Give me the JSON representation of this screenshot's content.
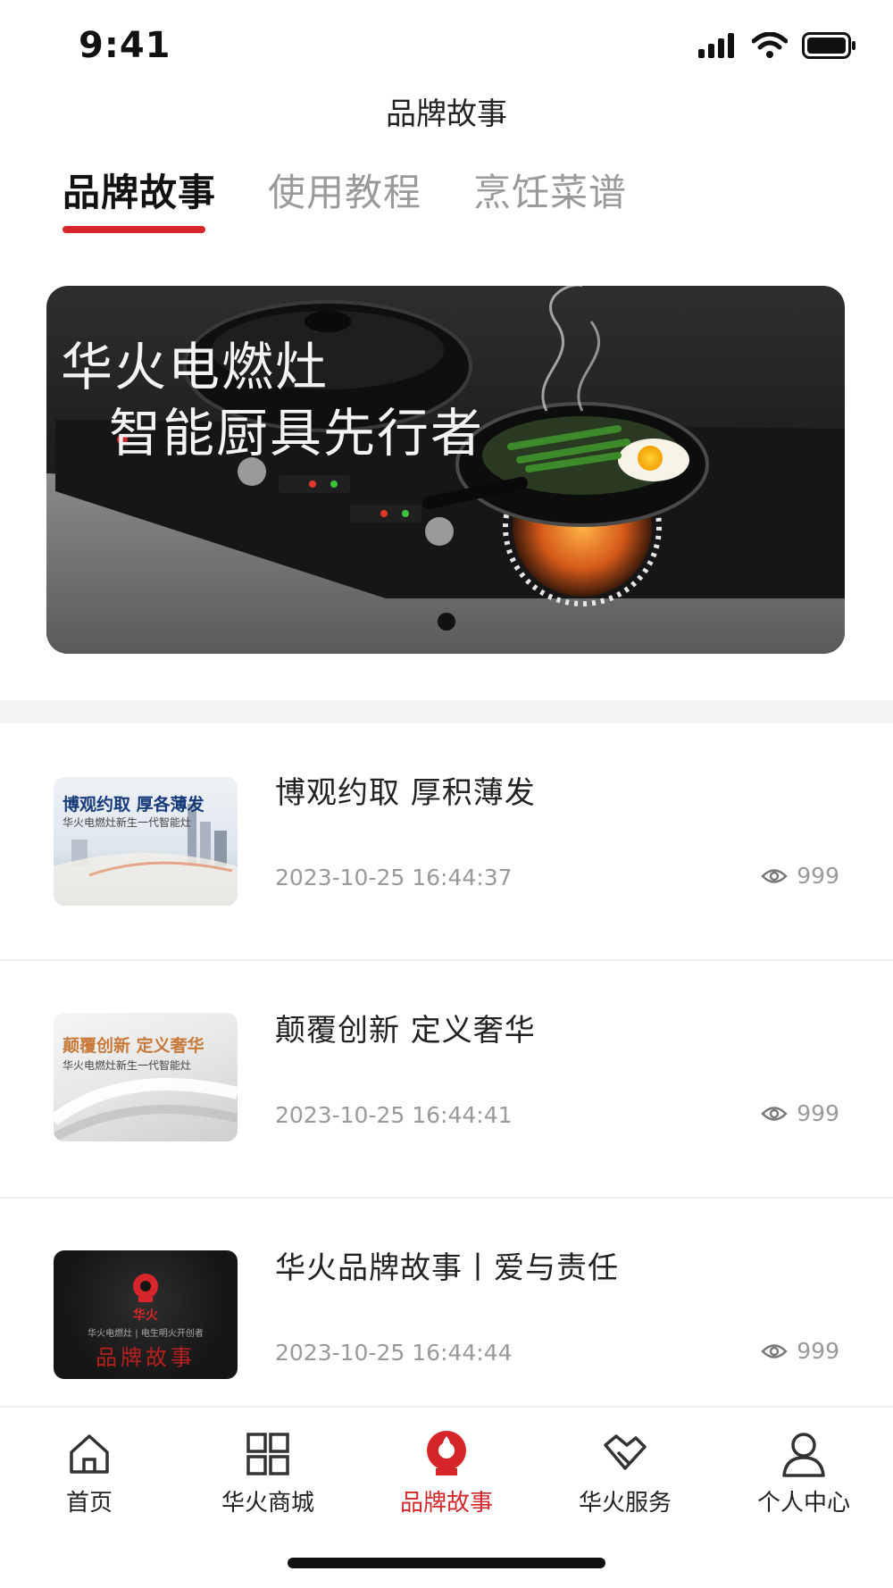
{
  "status_bar": {
    "time": "9:41"
  },
  "header": {
    "title": "品牌故事"
  },
  "tabs": [
    {
      "label": "品牌故事",
      "active": true
    },
    {
      "label": "使用教程",
      "active": false
    },
    {
      "label": "烹饪菜谱",
      "active": false
    }
  ],
  "banner": {
    "line1": "华火电燃灶",
    "line2": "智能厨具先行者",
    "page_count": 1,
    "current_page": 1
  },
  "news": [
    {
      "title": "博观约取 厚积薄发",
      "date": "2023-10-25 16:44:37",
      "views": "999",
      "thumb_title": "博观约取  厚各薄发",
      "thumb_sub": "华火电燃灶新生一代智能灶"
    },
    {
      "title": "颠覆创新 定义奢华",
      "date": "2023-10-25 16:44:41",
      "views": "999",
      "thumb_title": "颠覆创新  定义奢华",
      "thumb_sub": "华火电燃灶新生一代智能灶"
    },
    {
      "title": "华火品牌故事丨爱与责任",
      "date": "2023-10-25 16:44:44",
      "views": "999",
      "thumb_brand": "华火",
      "thumb_sub": "华火电燃灶 | 电生明火开创者",
      "thumb_title": "品牌故事"
    }
  ],
  "bottom_nav": [
    {
      "label": "首页",
      "icon": "home-icon",
      "active": false
    },
    {
      "label": "华火商城",
      "icon": "grid-icon",
      "active": false
    },
    {
      "label": "品牌故事",
      "icon": "brand-flame-icon",
      "active": true
    },
    {
      "label": "华火服务",
      "icon": "service-handshake-icon",
      "active": false
    },
    {
      "label": "个人中心",
      "icon": "user-icon",
      "active": false
    }
  ],
  "colors": {
    "accent": "#d6262a",
    "muted": "#9a9a9a",
    "text": "#222222"
  }
}
